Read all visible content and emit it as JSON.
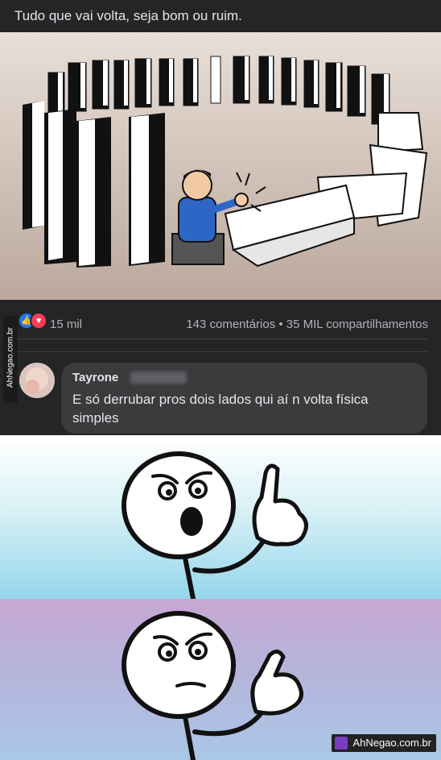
{
  "post": {
    "text": "Tudo que vai volta, seja bom ou ruim."
  },
  "reactions": {
    "icons": [
      "like-icon",
      "love-icon"
    ],
    "count": "15 mil",
    "comments_shares": "143 comentários • 35 MIL compartilhamentos"
  },
  "comment": {
    "author": "Tayrone",
    "text": "E só derrubar pros dois lados qui aí n volta física simples"
  },
  "watermark": {
    "side": "AhNegao.com.br",
    "corner": "AhNegao.com.br"
  },
  "colors": {
    "fb_background": "#242526",
    "bubble": "#3a3b3c",
    "text": "#e4e6eb",
    "muted": "#b0b3b8",
    "like": "#2078f4",
    "love": "#f33e58"
  }
}
